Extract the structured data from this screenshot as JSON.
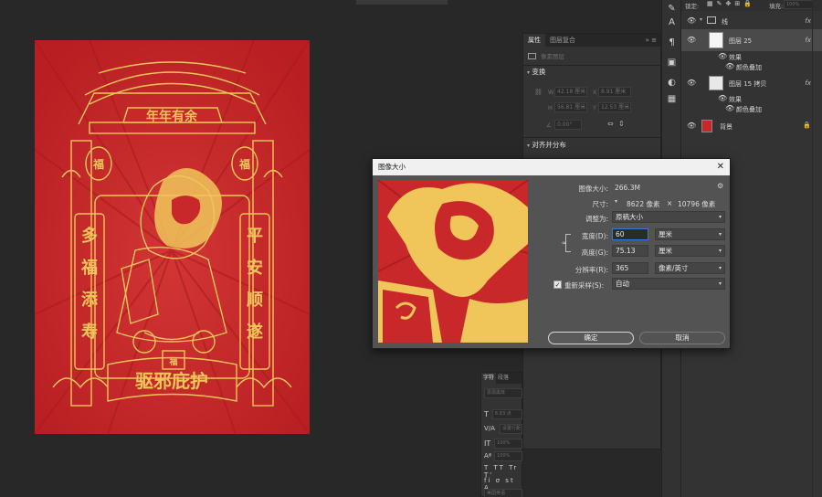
{
  "artwork": {
    "banner_top": "年年有余",
    "banner_bottom": "驱邪庇护",
    "couplet_left": [
      "多",
      "福",
      "添",
      "寿"
    ],
    "couplet_right": [
      "平",
      "安",
      "顺",
      "遂"
    ],
    "lantern_char": "福",
    "box_char": "福"
  },
  "props_panel": {
    "tabs": [
      "属性",
      "图层复合"
    ],
    "pixel_layer_label": "像素图层",
    "transform_label": "变换",
    "w_label": "W",
    "w_value": "42.18 厘米",
    "x_label": "X",
    "x_value": "8.91 厘米",
    "h_label": "H",
    "h_value": "56.81 厘米",
    "y_label": "Y",
    "y_value": "12.53 厘米",
    "angle_value": "0.00°",
    "align_label": "对齐并分布"
  },
  "layers_panel": {
    "lock_label": "锁定:",
    "fill_label": "填充:",
    "fill_value": "100%",
    "rows": [
      {
        "name": "线",
        "type": "group",
        "fx": "fx"
      },
      {
        "name": "图层 25",
        "type": "layer",
        "fx": "fx"
      },
      {
        "name": "效果",
        "type": "effect"
      },
      {
        "name": "颜色叠加",
        "type": "effect-item"
      },
      {
        "name": "图层 15 拷贝",
        "type": "layer",
        "fx": "fx"
      },
      {
        "name": "效果",
        "type": "effect"
      },
      {
        "name": "颜色叠加",
        "type": "effect-item"
      },
      {
        "name": "背景",
        "type": "background"
      }
    ]
  },
  "char_panel": {
    "tabs": [
      "字符",
      "段落"
    ],
    "font_family": "思源黑体",
    "font_size": "6.83 点",
    "leading": "设置行距",
    "tracking": "100%",
    "scale": "100%",
    "color_label": "颜色:",
    "lang": "美国英语"
  },
  "dialog": {
    "title": "图像大小",
    "image_size_label": "图像大小:",
    "image_size_value": "266.3M",
    "dimensions_label": "尺寸:",
    "dim_w": "8622 像素",
    "dim_x": "×",
    "dim_h": "10796 像素",
    "fit_label": "调整为:",
    "fit_value": "原稿大小",
    "width_label": "宽度(D):",
    "width_value": "60",
    "width_unit": "厘米",
    "height_label": "高度(G):",
    "height_value": "75.13",
    "height_unit": "厘米",
    "res_label": "分辨率(R):",
    "res_value": "365",
    "res_unit": "像素/英寸",
    "resample_label": "重新采样(S):",
    "resample_value": "自动",
    "resample_checked": true,
    "ok_label": "确定",
    "cancel_label": "取消"
  },
  "colors": {
    "art_red": "#c8282a",
    "art_gold": "#f0c65a",
    "swatch_red": "#c8282a"
  }
}
